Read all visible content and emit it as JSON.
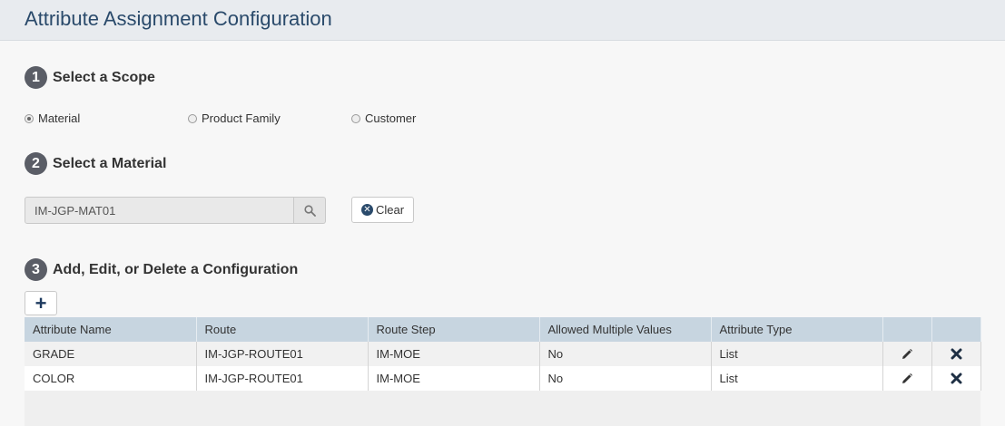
{
  "header": {
    "title": "Attribute Assignment Configuration"
  },
  "steps": [
    {
      "number": "1",
      "label": "Select a Scope"
    },
    {
      "number": "2",
      "label": "Select a Material"
    },
    {
      "number": "3",
      "label": "Add, Edit, or Delete a Configuration"
    }
  ],
  "scope": {
    "options": [
      {
        "label": "Material",
        "checked": true
      },
      {
        "label": "Product Family",
        "checked": false
      },
      {
        "label": "Customer",
        "checked": false
      }
    ]
  },
  "material": {
    "value": "IM-JGP-MAT01",
    "search_icon": "search-icon",
    "clear_label": "Clear",
    "clear_icon": "close-circle-icon"
  },
  "config": {
    "add_icon": "plus-icon",
    "columns": [
      "Attribute Name",
      "Route",
      "Route Step",
      "Allowed Multiple Values",
      "Attribute Type",
      "",
      ""
    ],
    "rows": [
      {
        "name": "GRADE",
        "route": "IM-JGP-ROUTE01",
        "step": "IM-MOE",
        "multiple": "No",
        "type": "List"
      },
      {
        "name": "COLOR",
        "route": "IM-JGP-ROUTE01",
        "step": "IM-MOE",
        "multiple": "No",
        "type": "List"
      }
    ],
    "edit_icon": "pencil-icon",
    "delete_icon": "delete-x-icon"
  },
  "colors": {
    "accent": "#2a4a6b",
    "header_bg": "#e8ebef",
    "grid_header": "#c7d5e0"
  }
}
